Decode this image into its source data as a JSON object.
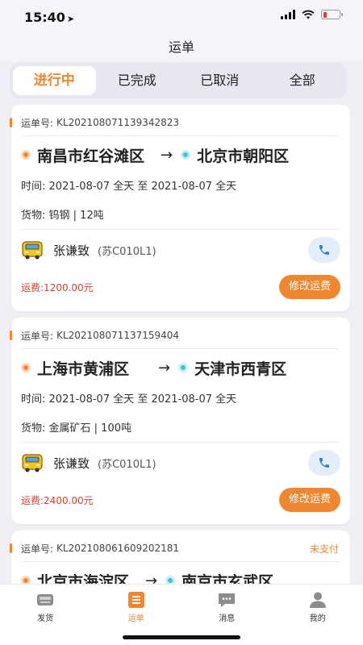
{
  "status_bar": {
    "time": "15:40"
  },
  "nav": {
    "title": "运单"
  },
  "tabs": [
    {
      "label": "进行中",
      "active": true
    },
    {
      "label": "已完成",
      "active": false
    },
    {
      "label": "已取消",
      "active": false
    },
    {
      "label": "全部",
      "active": false
    }
  ],
  "orders": [
    {
      "order_label": "运单号:",
      "order_no": "KL202108071139342823",
      "status": "",
      "from": "南昌市红谷滩区",
      "to": "北京市朝阳区",
      "time_label": "时间:",
      "time_value": "2021-08-07 全天 至 2021-08-07 全天",
      "goods_label": "货物:",
      "goods_value": "钨钢 | 12吨",
      "driver_name": "张谦致",
      "driver_plate": "(苏C010L1)",
      "fee_label": "运费:",
      "fee_value": "1200.00元",
      "action_label": "修改运费"
    },
    {
      "order_label": "运单号:",
      "order_no": "KL202108071137159404",
      "status": "",
      "from": "上海市黄浦区",
      "to": "天津市西青区",
      "time_label": "时间:",
      "time_value": "2021-08-07 全天 至 2021-08-07 全天",
      "goods_label": "货物:",
      "goods_value": "金属矿石 | 100吨",
      "driver_name": "张谦致",
      "driver_plate": "(苏C010L1)",
      "fee_label": "运费:",
      "fee_value": "2400.00元",
      "action_label": "修改运费"
    },
    {
      "order_label": "运单号:",
      "order_no": "KL202108061609202181",
      "status": "未支付",
      "from": "北京市海淀区",
      "to": "南京市玄武区"
    }
  ],
  "tabbar": [
    {
      "label": "发货",
      "icon": "truck-ship-icon",
      "active": false
    },
    {
      "label": "运单",
      "icon": "waybill-icon",
      "active": true
    },
    {
      "label": "消息",
      "icon": "message-icon",
      "active": false
    },
    {
      "label": "我的",
      "icon": "profile-icon",
      "active": false
    }
  ],
  "colors": {
    "accent": "#f0862f",
    "fee_red": "#e03c31",
    "origin_dot": "#f0862f",
    "destination_dot": "#3cc4dc",
    "page_bg": "#eef0f6"
  }
}
